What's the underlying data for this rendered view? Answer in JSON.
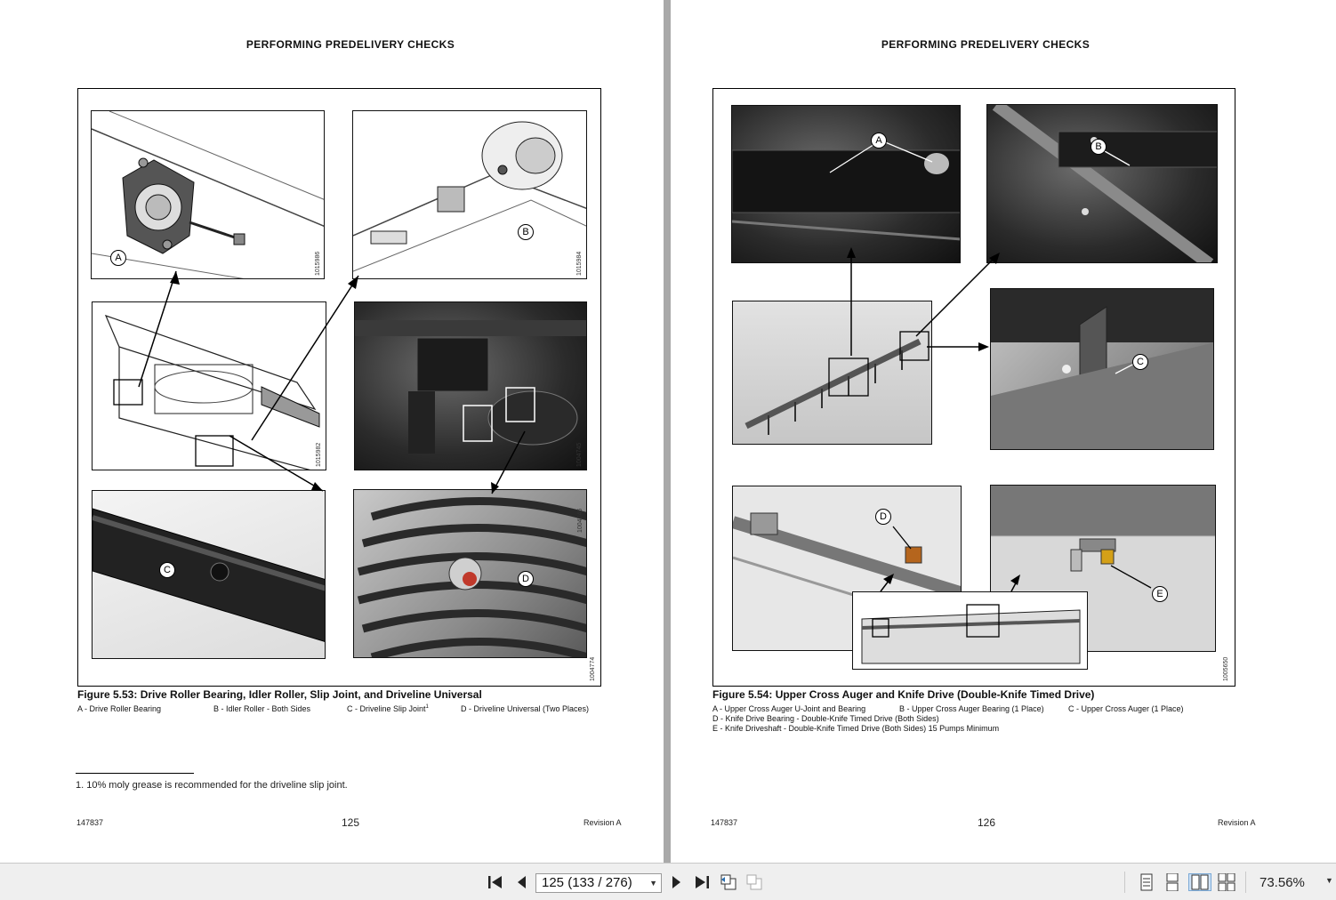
{
  "left_page": {
    "running_head": "PERFORMING PREDELIVERY CHECKS",
    "figure": {
      "caption": "Figure 5.53: Drive Roller Bearing, Idler Roller, Slip Joint, and Driveline Universal",
      "legend": [
        "A - Drive Roller Bearing",
        "B - Idler Roller - Both Sides",
        "C - Driveline Slip Joint",
        "D - Driveline Universal (Two Places)"
      ],
      "legend_footnote_mark": "1",
      "callouts": [
        "A",
        "B",
        "C",
        "D"
      ],
      "part_numbers": [
        "1015986",
        "1015984",
        "1015982",
        "1004745",
        "1004746",
        "1004774"
      ]
    },
    "footnote": "1.  10% moly grease is recommended for the driveline slip joint.",
    "footer": {
      "doc_number": "147837",
      "page_number": "125",
      "revision": "Revision  A"
    }
  },
  "right_page": {
    "running_head": "PERFORMING PREDELIVERY CHECKS",
    "figure": {
      "caption": "Figure 5.54: Upper Cross Auger and Knife Drive (Double-Knife Timed Drive)",
      "legend_row1": [
        "A - Upper Cross Auger U-Joint and Bearing",
        "B - Upper Cross Auger Bearing (1 Place)",
        "C - Upper Cross Auger (1 Place)"
      ],
      "legend_row2": "D - Knife Drive Bearing - Double-Knife Timed Drive (Both Sides)",
      "legend_row3": "E - Knife Driveshaft - Double-Knife Timed Drive (Both Sides) 15 Pumps Minimum",
      "callouts": [
        "A",
        "B",
        "C",
        "D",
        "E"
      ],
      "part_number": "1005650"
    },
    "footer": {
      "doc_number": "147837",
      "page_number": "126",
      "revision": "Revision  A"
    }
  },
  "toolbar": {
    "page_indicator": "125 (133 / 276)",
    "zoom": "73.56%",
    "icons": [
      "first-page-icon",
      "previous-page-icon",
      "next-page-icon",
      "last-page-icon",
      "previous-view-icon",
      "next-view-icon",
      "single-page-icon",
      "continuous-icon",
      "facing-pages-icon",
      "continuous-facing-icon"
    ]
  }
}
